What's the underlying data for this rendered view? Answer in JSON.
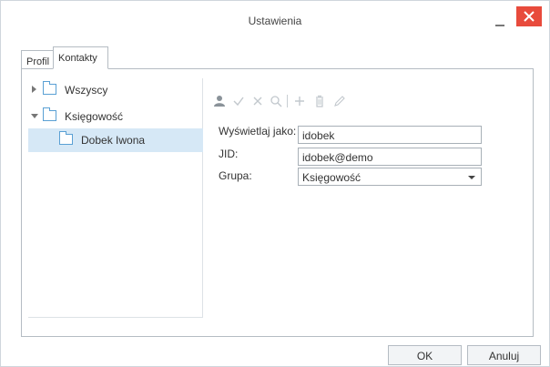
{
  "window": {
    "title": "Ustawienia"
  },
  "tabs": [
    {
      "label": "Profil"
    },
    {
      "label": "Kontakty"
    }
  ],
  "tree": {
    "items": [
      {
        "label": "Wszyscy"
      },
      {
        "label": "Księgowość"
      },
      {
        "label": "Dobek Iwona"
      }
    ]
  },
  "toolbar": {
    "icons": [
      "user-icon",
      "check-icon",
      "x-icon",
      "search-icon",
      "plus-icon",
      "trash-icon",
      "pencil-icon"
    ]
  },
  "form": {
    "display_as_label": "Wyświetlaj jako:",
    "display_as_value": "idobek",
    "jid_label": "JID:",
    "jid_value": "idobek@demo",
    "group_label": "Grupa:",
    "group_value": "Księgowość"
  },
  "buttons": {
    "ok": "OK",
    "cancel": "Anuluj"
  },
  "colors": {
    "close": "#e84b3c",
    "selection": "#d6e8f6",
    "folder": "#5aa0d4"
  }
}
